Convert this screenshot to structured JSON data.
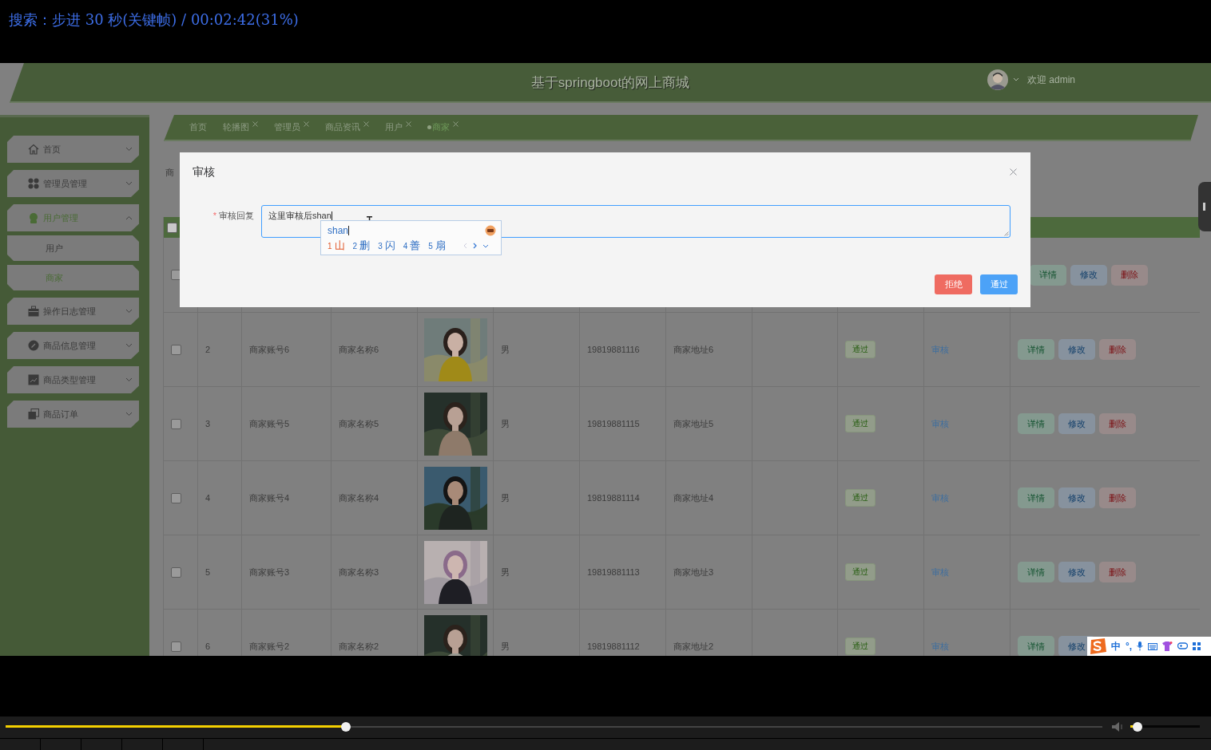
{
  "player": {
    "osd": "搜索：步进 30 秒(关键帧) / 00:02:42(31%)",
    "seek": {
      "level": 0.31
    },
    "volume": {
      "level": 0.1
    }
  },
  "app": {
    "header": {
      "title": "基于springboot的网上商城",
      "welcome": "欢迎 admin"
    },
    "sidebar": {
      "items": [
        {
          "label": "首页",
          "selected": false,
          "expanded": false
        },
        {
          "label": "管理员管理",
          "selected": false,
          "expanded": false
        },
        {
          "label": "用户管理",
          "selected": true,
          "expanded": true,
          "children": [
            {
              "label": "用户",
              "selected": false
            },
            {
              "label": "商家",
              "selected": true
            }
          ]
        },
        {
          "label": "操作日志管理",
          "selected": false,
          "expanded": false
        },
        {
          "label": "商品信息管理",
          "selected": false,
          "expanded": false
        },
        {
          "label": "商品类型管理",
          "selected": false,
          "expanded": false
        },
        {
          "label": "商品订单",
          "selected": false,
          "expanded": false
        }
      ]
    },
    "tabs": [
      {
        "label": "首页",
        "selected": false,
        "closable": false
      },
      {
        "label": "轮播图",
        "selected": false,
        "closable": true
      },
      {
        "label": "管理员",
        "selected": false,
        "closable": true
      },
      {
        "label": "商品资讯",
        "selected": false,
        "closable": true
      },
      {
        "label": "用户",
        "selected": false,
        "closable": true
      },
      {
        "label": "商家",
        "selected": true,
        "closable": true
      }
    ],
    "breadcrumb": "商",
    "table": {
      "header_checked": false,
      "rows": [
        {
          "checked": false,
          "actions": [
            {
              "label": "详情",
              "kind": "detail"
            },
            {
              "label": "修改",
              "kind": "edit"
            },
            {
              "label": "删除",
              "kind": "delete"
            }
          ]
        },
        {
          "checked": false,
          "index": "2",
          "account": "商家账号6",
          "name": "商家名称6",
          "image": {
            "kind": "picture"
          },
          "gender": "男",
          "phone": "19819881116",
          "address": "商家地址6",
          "status": "通过",
          "audit": "审核",
          "actions": [
            {
              "label": "详情",
              "kind": "detail"
            },
            {
              "label": "修改",
              "kind": "edit"
            },
            {
              "label": "删除",
              "kind": "delete"
            }
          ]
        },
        {
          "checked": false,
          "index": "3",
          "account": "商家账号5",
          "name": "商家名称5",
          "image": {
            "kind": "picture"
          },
          "gender": "男",
          "phone": "19819881115",
          "address": "商家地址5",
          "status": "通过",
          "audit": "审核",
          "actions": [
            {
              "label": "详情",
              "kind": "detail"
            },
            {
              "label": "修改",
              "kind": "edit"
            },
            {
              "label": "删除",
              "kind": "delete"
            }
          ]
        },
        {
          "checked": false,
          "index": "4",
          "account": "商家账号4",
          "name": "商家名称4",
          "image": {
            "kind": "picture"
          },
          "gender": "男",
          "phone": "19819881114",
          "address": "商家地址4",
          "status": "通过",
          "audit": "审核",
          "actions": [
            {
              "label": "详情",
              "kind": "detail"
            },
            {
              "label": "修改",
              "kind": "edit"
            },
            {
              "label": "删除",
              "kind": "delete"
            }
          ]
        },
        {
          "checked": false,
          "index": "5",
          "account": "商家账号3",
          "name": "商家名称3",
          "image": {
            "kind": "picture"
          },
          "gender": "男",
          "phone": "19819881113",
          "address": "商家地址3",
          "status": "通过",
          "audit": "审核",
          "actions": [
            {
              "label": "详情",
              "kind": "detail"
            },
            {
              "label": "修改",
              "kind": "edit"
            },
            {
              "label": "删除",
              "kind": "delete"
            }
          ]
        },
        {
          "checked": false,
          "index": "6",
          "account": "商家账号2",
          "name": "商家名称2",
          "image": {
            "kind": "picture"
          },
          "gender": "男",
          "phone": "19819881112",
          "address": "商家地址2",
          "status": "通过",
          "audit": "审核",
          "actions": [
            {
              "label": "详情",
              "kind": "detail"
            },
            {
              "label": "修改",
              "kind": "edit"
            }
          ]
        }
      ]
    }
  },
  "dialog": {
    "title": "审核",
    "field": {
      "required_mark": "*",
      "label": "审核回复",
      "value": "这里审核后shan"
    },
    "buttons": [
      {
        "label": "拒绝",
        "kind": "danger"
      },
      {
        "label": "通过",
        "kind": "primary"
      }
    ]
  },
  "ime": {
    "composition": "shan",
    "candidates": [
      {
        "num": "1",
        "char": "山",
        "selected": true
      },
      {
        "num": "2",
        "char": "删",
        "selected": false
      },
      {
        "num": "3",
        "char": "闪",
        "selected": false
      },
      {
        "num": "4",
        "char": "善",
        "selected": false
      },
      {
        "num": "5",
        "char": "扇",
        "selected": false
      }
    ],
    "toolbar": {
      "mode": "中",
      "punct": "°,"
    }
  }
}
